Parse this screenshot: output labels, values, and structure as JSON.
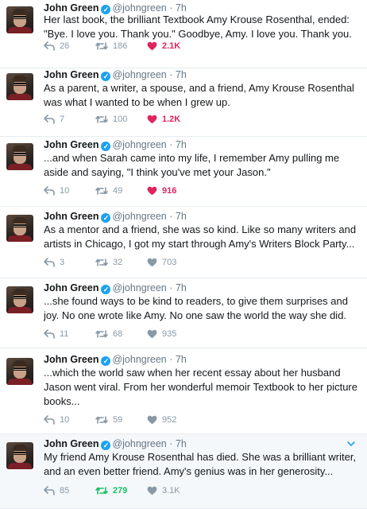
{
  "author": {
    "name": "John Green",
    "handle": "@johngreen",
    "dot": "·",
    "time": "7h"
  },
  "tweets": [
    {
      "text": "Her last book, the brilliant Textbook Amy Krouse Rosenthal, ended: \"Bye. I love you. Thank you.\" Goodbye, Amy. I love you. Thank you.",
      "replies": "26",
      "retweets": "186",
      "likes": "2.1K",
      "liked": true,
      "retweeted": false
    },
    {
      "text": "As a parent, a writer, a spouse, and a friend, Amy Krouse Rosenthal was what I wanted to be when I grew up.",
      "replies": "7",
      "retweets": "100",
      "likes": "1.2K",
      "liked": true,
      "retweeted": false
    },
    {
      "text": "...and when Sarah came into my life, I remember Amy pulling me aside and saying, \"I think you've met your Jason.\"",
      "replies": "10",
      "retweets": "49",
      "likes": "916",
      "liked": true,
      "retweeted": false
    },
    {
      "text": "As a mentor and a friend, she was so kind. Like so many writers and artists in Chicago, I got my start through Amy's Writers Block Party...",
      "replies": "3",
      "retweets": "32",
      "likes": "703",
      "liked": false,
      "retweeted": false
    },
    {
      "text": "...she found ways to be kind to readers, to give them surprises and joy. No one wrote like Amy. No one saw the world the way she did.",
      "replies": "11",
      "retweets": "68",
      "likes": "935",
      "liked": false,
      "retweeted": false
    },
    {
      "text": "...which the world saw when her recent essay about her husband Jason went viral. From her wonderful memoir Textbook to her picture books...",
      "replies": "10",
      "retweets": "59",
      "likes": "952",
      "liked": false,
      "retweeted": false
    },
    {
      "text": "My friend Amy Krouse Rosenthal has died. She was a brilliant writer, and an even better friend. Amy's genius was in her generosity...",
      "replies": "85",
      "retweets": "279",
      "likes": "3.1K",
      "liked": false,
      "retweeted": true
    }
  ],
  "colors": {
    "like_active": "#e0245e",
    "retweet_active": "#17bf63",
    "verified": "#1da1f2",
    "icon_default": "#8899a6"
  }
}
